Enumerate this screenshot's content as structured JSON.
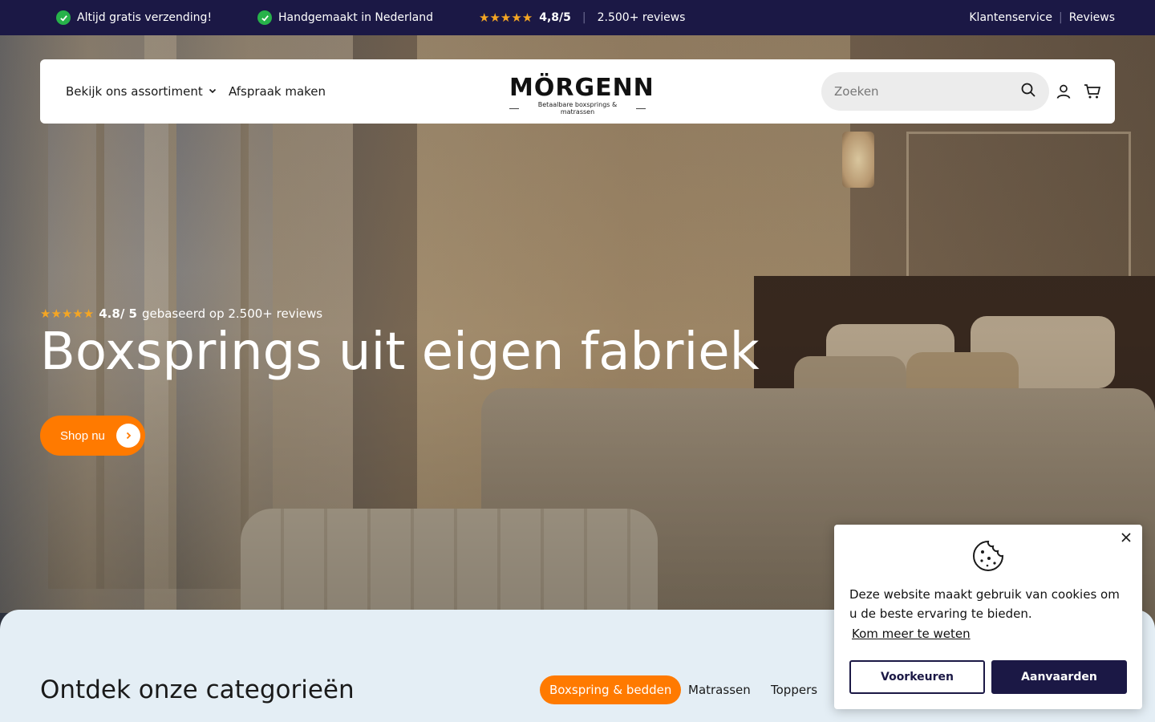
{
  "topbar": {
    "usp1": "Altijd gratis verzending!",
    "usp2": "Handgemaakt in Nederland",
    "stars": "★★★★★",
    "rating": "4,8/5",
    "reviews": "2.500+ reviews",
    "link_service": "Klantenservice",
    "link_divider": "|",
    "link_reviews": "Reviews"
  },
  "header": {
    "nav_assortment": "Bekijk ons assortiment",
    "nav_appointment": "Afspraak maken",
    "logo_mark": "MÖRGENN",
    "logo_tagline": "Betaalbare boxsprings & matrassen",
    "search_placeholder": "Zoeken"
  },
  "hero": {
    "stars": "★★★★★",
    "rating": "4.8/ 5",
    "rating_text": "gebaseerd op 2.500+ reviews",
    "title": "Boxsprings uit eigen fabriek",
    "cta": "Shop nu"
  },
  "categories": {
    "heading": "Ontdek onze categorieën",
    "tabs": [
      {
        "label": "Boxspring & bedden"
      },
      {
        "label": "Matrassen"
      },
      {
        "label": "Toppers"
      }
    ]
  },
  "cookie": {
    "message": "Deze website maakt gebruik van cookies om u de beste ervaring te bieden.",
    "learn_more": "Kom meer te weten",
    "preferences": "Voorkeuren",
    "accept": "Aanvaarden"
  },
  "colors": {
    "topbar_bg": "#1b1845",
    "accent": "#ff7a00",
    "check_green": "#27b24a",
    "star": "#f5a623"
  }
}
